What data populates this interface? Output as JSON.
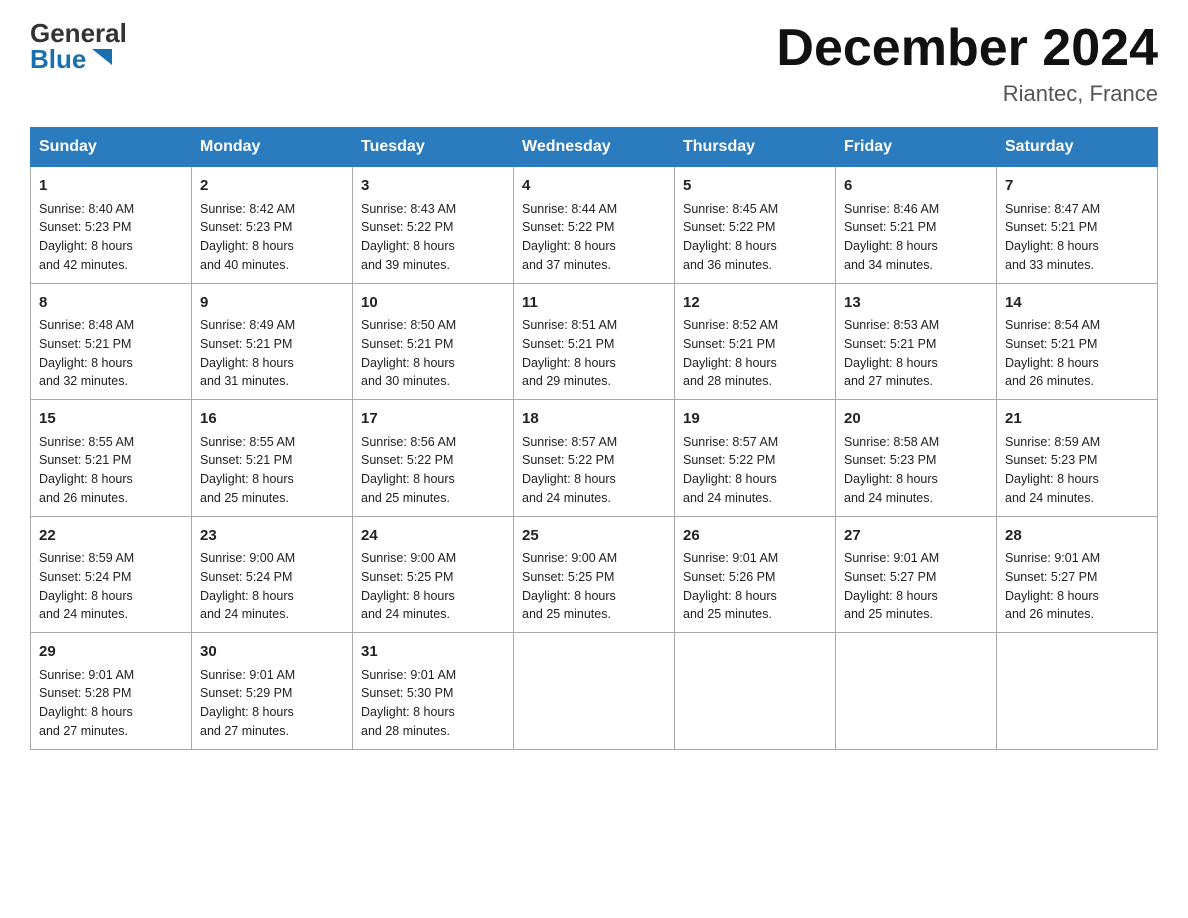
{
  "header": {
    "logo_general": "General",
    "logo_blue": "Blue",
    "month_title": "December 2024",
    "location": "Riantec, France"
  },
  "days_of_week": [
    "Sunday",
    "Monday",
    "Tuesday",
    "Wednesday",
    "Thursday",
    "Friday",
    "Saturday"
  ],
  "weeks": [
    [
      {
        "num": "1",
        "info": "Sunrise: 8:40 AM\nSunset: 5:23 PM\nDaylight: 8 hours\nand 42 minutes."
      },
      {
        "num": "2",
        "info": "Sunrise: 8:42 AM\nSunset: 5:23 PM\nDaylight: 8 hours\nand 40 minutes."
      },
      {
        "num": "3",
        "info": "Sunrise: 8:43 AM\nSunset: 5:22 PM\nDaylight: 8 hours\nand 39 minutes."
      },
      {
        "num": "4",
        "info": "Sunrise: 8:44 AM\nSunset: 5:22 PM\nDaylight: 8 hours\nand 37 minutes."
      },
      {
        "num": "5",
        "info": "Sunrise: 8:45 AM\nSunset: 5:22 PM\nDaylight: 8 hours\nand 36 minutes."
      },
      {
        "num": "6",
        "info": "Sunrise: 8:46 AM\nSunset: 5:21 PM\nDaylight: 8 hours\nand 34 minutes."
      },
      {
        "num": "7",
        "info": "Sunrise: 8:47 AM\nSunset: 5:21 PM\nDaylight: 8 hours\nand 33 minutes."
      }
    ],
    [
      {
        "num": "8",
        "info": "Sunrise: 8:48 AM\nSunset: 5:21 PM\nDaylight: 8 hours\nand 32 minutes."
      },
      {
        "num": "9",
        "info": "Sunrise: 8:49 AM\nSunset: 5:21 PM\nDaylight: 8 hours\nand 31 minutes."
      },
      {
        "num": "10",
        "info": "Sunrise: 8:50 AM\nSunset: 5:21 PM\nDaylight: 8 hours\nand 30 minutes."
      },
      {
        "num": "11",
        "info": "Sunrise: 8:51 AM\nSunset: 5:21 PM\nDaylight: 8 hours\nand 29 minutes."
      },
      {
        "num": "12",
        "info": "Sunrise: 8:52 AM\nSunset: 5:21 PM\nDaylight: 8 hours\nand 28 minutes."
      },
      {
        "num": "13",
        "info": "Sunrise: 8:53 AM\nSunset: 5:21 PM\nDaylight: 8 hours\nand 27 minutes."
      },
      {
        "num": "14",
        "info": "Sunrise: 8:54 AM\nSunset: 5:21 PM\nDaylight: 8 hours\nand 26 minutes."
      }
    ],
    [
      {
        "num": "15",
        "info": "Sunrise: 8:55 AM\nSunset: 5:21 PM\nDaylight: 8 hours\nand 26 minutes."
      },
      {
        "num": "16",
        "info": "Sunrise: 8:55 AM\nSunset: 5:21 PM\nDaylight: 8 hours\nand 25 minutes."
      },
      {
        "num": "17",
        "info": "Sunrise: 8:56 AM\nSunset: 5:22 PM\nDaylight: 8 hours\nand 25 minutes."
      },
      {
        "num": "18",
        "info": "Sunrise: 8:57 AM\nSunset: 5:22 PM\nDaylight: 8 hours\nand 24 minutes."
      },
      {
        "num": "19",
        "info": "Sunrise: 8:57 AM\nSunset: 5:22 PM\nDaylight: 8 hours\nand 24 minutes."
      },
      {
        "num": "20",
        "info": "Sunrise: 8:58 AM\nSunset: 5:23 PM\nDaylight: 8 hours\nand 24 minutes."
      },
      {
        "num": "21",
        "info": "Sunrise: 8:59 AM\nSunset: 5:23 PM\nDaylight: 8 hours\nand 24 minutes."
      }
    ],
    [
      {
        "num": "22",
        "info": "Sunrise: 8:59 AM\nSunset: 5:24 PM\nDaylight: 8 hours\nand 24 minutes."
      },
      {
        "num": "23",
        "info": "Sunrise: 9:00 AM\nSunset: 5:24 PM\nDaylight: 8 hours\nand 24 minutes."
      },
      {
        "num": "24",
        "info": "Sunrise: 9:00 AM\nSunset: 5:25 PM\nDaylight: 8 hours\nand 24 minutes."
      },
      {
        "num": "25",
        "info": "Sunrise: 9:00 AM\nSunset: 5:25 PM\nDaylight: 8 hours\nand 25 minutes."
      },
      {
        "num": "26",
        "info": "Sunrise: 9:01 AM\nSunset: 5:26 PM\nDaylight: 8 hours\nand 25 minutes."
      },
      {
        "num": "27",
        "info": "Sunrise: 9:01 AM\nSunset: 5:27 PM\nDaylight: 8 hours\nand 25 minutes."
      },
      {
        "num": "28",
        "info": "Sunrise: 9:01 AM\nSunset: 5:27 PM\nDaylight: 8 hours\nand 26 minutes."
      }
    ],
    [
      {
        "num": "29",
        "info": "Sunrise: 9:01 AM\nSunset: 5:28 PM\nDaylight: 8 hours\nand 27 minutes."
      },
      {
        "num": "30",
        "info": "Sunrise: 9:01 AM\nSunset: 5:29 PM\nDaylight: 8 hours\nand 27 minutes."
      },
      {
        "num": "31",
        "info": "Sunrise: 9:01 AM\nSunset: 5:30 PM\nDaylight: 8 hours\nand 28 minutes."
      },
      {
        "num": "",
        "info": ""
      },
      {
        "num": "",
        "info": ""
      },
      {
        "num": "",
        "info": ""
      },
      {
        "num": "",
        "info": ""
      }
    ]
  ]
}
